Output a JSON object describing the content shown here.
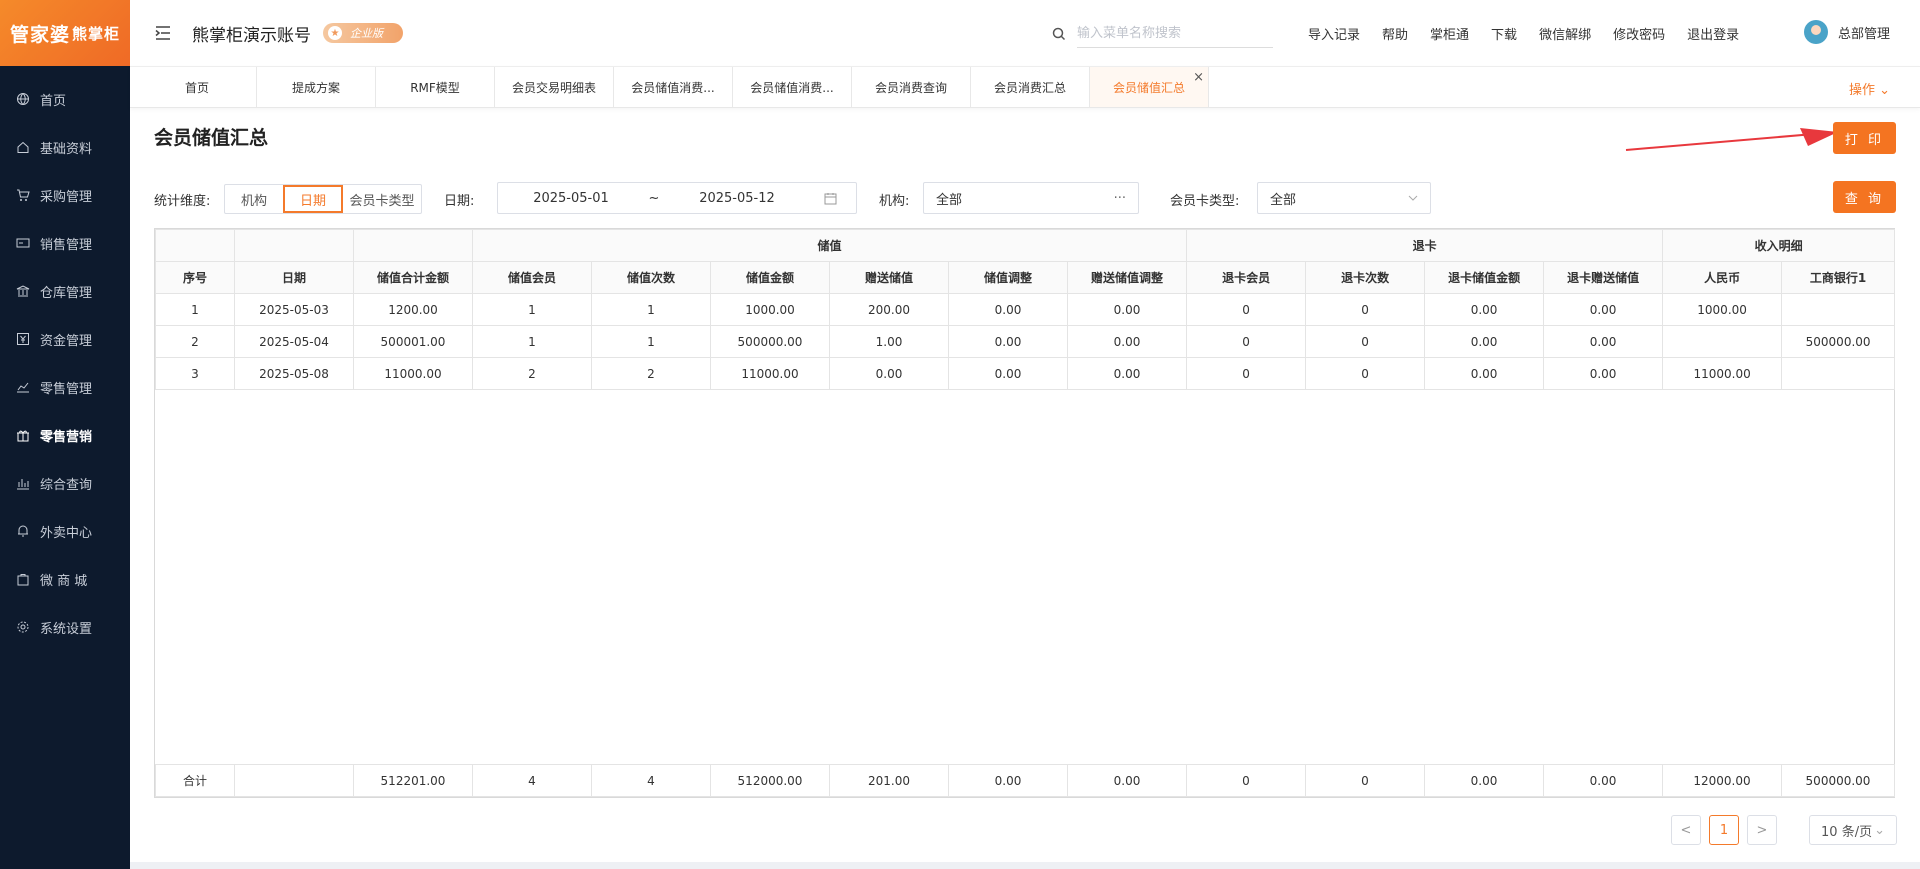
{
  "sidebar": {
    "logo_main": "管家婆",
    "logo_sub": "熊掌柜",
    "items": [
      {
        "label": "首页",
        "icon": "globe-icon"
      },
      {
        "label": "基础资料",
        "icon": "home-icon"
      },
      {
        "label": "采购管理",
        "icon": "cart-icon"
      },
      {
        "label": "销售管理",
        "icon": "card-icon"
      },
      {
        "label": "仓库管理",
        "icon": "bank-icon"
      },
      {
        "label": "资金管理",
        "icon": "yen-icon"
      },
      {
        "label": "零售管理",
        "icon": "trend-icon"
      },
      {
        "label": "零售营销",
        "icon": "gift-icon"
      },
      {
        "label": "综合查询",
        "icon": "bar-chart-icon"
      },
      {
        "label": "外卖中心",
        "icon": "bell-icon"
      },
      {
        "label": "微 商 城",
        "icon": "bag-icon"
      },
      {
        "label": "系统设置",
        "icon": "gear-icon"
      }
    ]
  },
  "header": {
    "account": "熊掌柜演示账号",
    "edition": "企业版",
    "search_placeholder": "输入菜单名称搜索",
    "links": [
      "导入记录",
      "帮助",
      "掌柜通",
      "下载",
      "微信解绑",
      "修改密码",
      "退出登录"
    ],
    "user": "总部管理"
  },
  "tabs": [
    "首页",
    "提成方案",
    "RMF模型",
    "会员交易明细表",
    "会员储值消费...",
    "会员储值消费...",
    "会员消费查询",
    "会员消费汇总",
    "会员储值汇总"
  ],
  "ops_label": "操作",
  "page_title": "会员储值汇总",
  "print_label": "打 印",
  "query_label": "查 询",
  "filters": {
    "dimension_label": "统计维度:",
    "dimension_options": [
      "机构",
      "日期",
      "会员卡类型"
    ],
    "dimension_selected": "日期",
    "date_label": "日期:",
    "date_start": "2025-05-01",
    "date_sep": "~",
    "date_end": "2025-05-12",
    "org_label": "机构:",
    "org_value": "全部",
    "cardtype_label": "会员卡类型:",
    "cardtype_value": "全部"
  },
  "table": {
    "group_headers": {
      "stored": "储值",
      "refund": "退卡",
      "income": "收入明细"
    },
    "columns": [
      "序号",
      "日期",
      "储值合计金额",
      "储值会员",
      "储值次数",
      "储值金额",
      "赠送储值",
      "储值调整",
      "赠送储值调整",
      "退卡会员",
      "退卡次数",
      "退卡储值金额",
      "退卡赠送储值",
      "人民币",
      "工商银行1"
    ],
    "rows": [
      [
        "1",
        "2025-05-03",
        "1200.00",
        "1",
        "1",
        "1000.00",
        "200.00",
        "0.00",
        "0.00",
        "0",
        "0",
        "0.00",
        "0.00",
        "1000.00",
        ""
      ],
      [
        "2",
        "2025-05-04",
        "500001.00",
        "1",
        "1",
        "500000.00",
        "1.00",
        "0.00",
        "0.00",
        "0",
        "0",
        "0.00",
        "0.00",
        "",
        "500000.00"
      ],
      [
        "3",
        "2025-05-08",
        "11000.00",
        "2",
        "2",
        "11000.00",
        "0.00",
        "0.00",
        "0.00",
        "0",
        "0",
        "0.00",
        "0.00",
        "11000.00",
        ""
      ]
    ],
    "footer": [
      "合计",
      "",
      "512201.00",
      "4",
      "4",
      "512000.00",
      "201.00",
      "0.00",
      "0.00",
      "0",
      "0",
      "0.00",
      "0.00",
      "12000.00",
      "500000.00"
    ]
  },
  "pager": {
    "prev": "<",
    "current": "1",
    "next": ">",
    "page_size": "10 条/页"
  },
  "colors": {
    "accent": "#f47421",
    "sidebar_bg": "#0d1a2d"
  }
}
